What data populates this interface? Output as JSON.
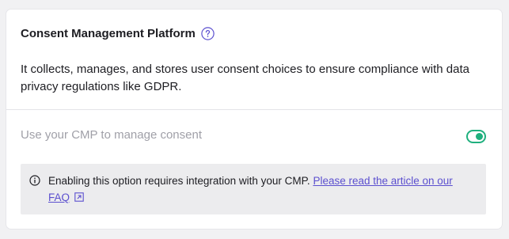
{
  "header": {
    "title": "Consent Management Platform",
    "help_icon": "question-circle-icon"
  },
  "description": "It collects, manages, and stores user consent choices to ensure compliance with data privacy regulations like GDPR.",
  "cmp_toggle": {
    "label": "Use your CMP to manage consent",
    "enabled": true
  },
  "notice": {
    "icon": "info-circle-icon",
    "text": "Enabling this option requires integration with your CMP. ",
    "link_text": "Please read the article on our FAQ",
    "link_icon": "external-link-icon"
  },
  "colors": {
    "accent": "#5b4fcf",
    "toggle_on": "#1fb07e",
    "notice_bg": "#ececee"
  }
}
